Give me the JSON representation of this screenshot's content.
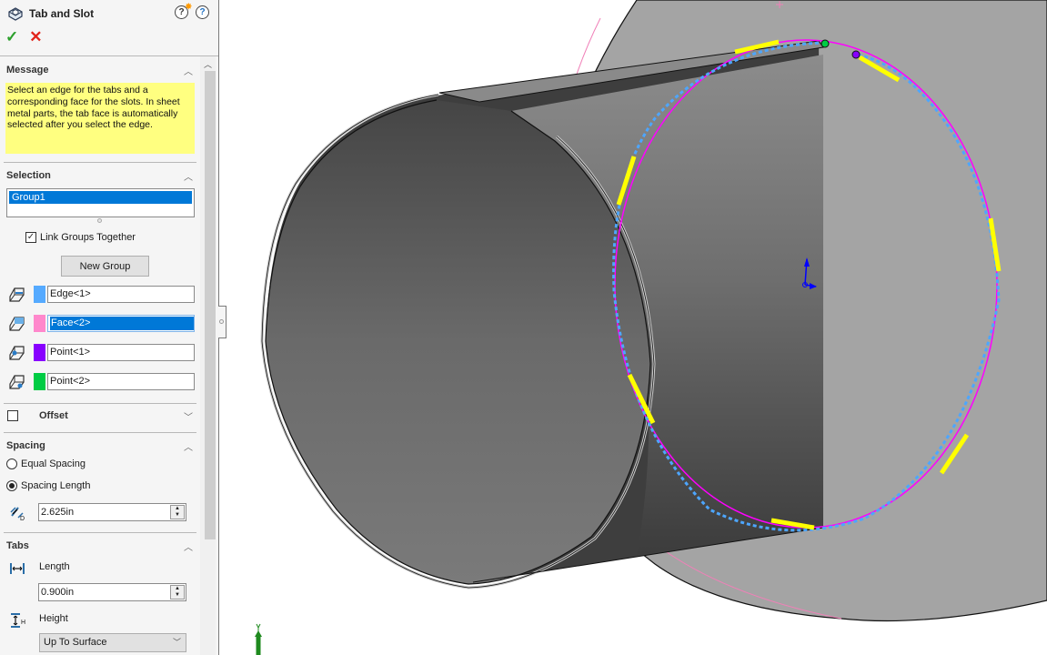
{
  "panel": {
    "title": "Tab and Slot",
    "icons": [
      "tab-and-slot-feature-icon",
      "whats-new-help-icon",
      "help-icon"
    ],
    "ok_label": "✓",
    "cancel_label": "✕"
  },
  "message": {
    "header": "Message",
    "text": "Select an edge for the tabs and a corresponding face for the slots. In sheet metal parts, the tab face is automatically selected after you select the edge."
  },
  "selection": {
    "header": "Selection",
    "groups": [
      "Group1"
    ],
    "link_groups_label": "Link Groups Together",
    "link_groups_checked": true,
    "new_group_label": "New Group",
    "items": [
      {
        "label": "Edge<1>",
        "color": "#55aaff",
        "icon": "edge-selection-icon",
        "active": false
      },
      {
        "label": "Face<2>",
        "color": "#ff88cc",
        "icon": "face-selection-icon",
        "active": true
      },
      {
        "label": "Point<1>",
        "color": "#8800ff",
        "icon": "start-point-icon",
        "active": false
      },
      {
        "label": "Point<2>",
        "color": "#00cc44",
        "icon": "end-point-icon",
        "active": false
      }
    ]
  },
  "offset": {
    "header": "Offset",
    "checked": false
  },
  "spacing": {
    "header": "Spacing",
    "options": [
      "Equal Spacing",
      "Spacing Length"
    ],
    "selected": "Spacing Length",
    "value": "2.625in"
  },
  "tabs": {
    "header": "Tabs",
    "length_label": "Length",
    "length_value": "0.900in",
    "height_label": "Height",
    "height_option": "Up To Surface"
  },
  "colors": {
    "selection_blue": "#0078d7",
    "message_yellow": "#ffff80",
    "edge_highlight": "#4da6ff",
    "face_outline": "#ff00ff",
    "tab_highlight": "#ffff00"
  }
}
